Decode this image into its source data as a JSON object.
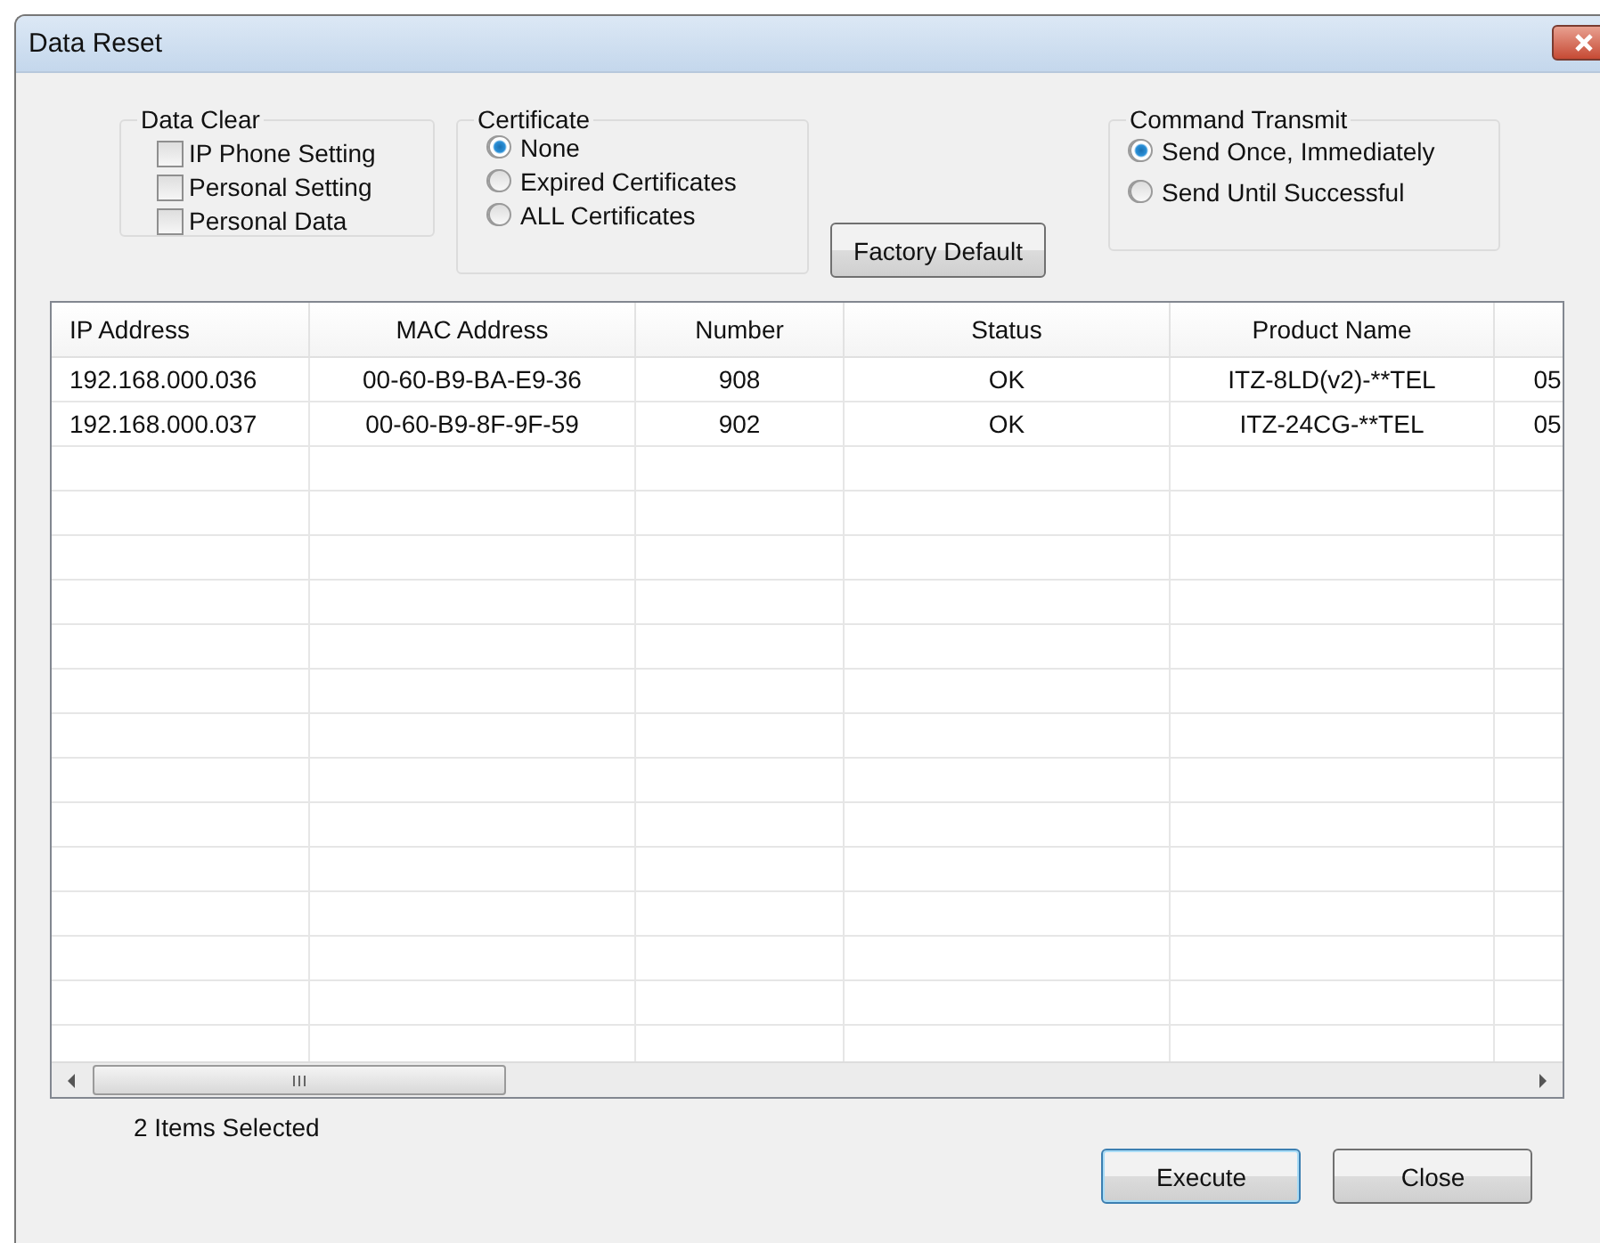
{
  "window": {
    "title": "Data Reset"
  },
  "data_clear": {
    "title": "Data Clear",
    "options": [
      {
        "label": "IP Phone Setting",
        "checked": false
      },
      {
        "label": "Personal Setting",
        "checked": false
      },
      {
        "label": "Personal Data",
        "checked": false
      }
    ]
  },
  "certificate": {
    "title": "Certificate",
    "options": [
      {
        "label": "None",
        "selected": true
      },
      {
        "label": "Expired Certificates",
        "selected": false
      },
      {
        "label": "ALL Certificates",
        "selected": false
      }
    ]
  },
  "factory_default_button": "Factory Default",
  "command_transmit": {
    "title": "Command Transmit",
    "options": [
      {
        "label": "Send Once, Immediately",
        "selected": true
      },
      {
        "label": "Send Until Successful",
        "selected": false
      }
    ]
  },
  "table": {
    "columns": [
      "IP Address",
      "MAC Address",
      "Number",
      "Status",
      "Product Name"
    ],
    "rows": [
      {
        "cells": [
          "192.168.000.036",
          "00-60-B9-BA-E9-36",
          "908",
          "OK",
          "ITZ-8LD(v2)-**TEL",
          "05"
        ]
      },
      {
        "cells": [
          "192.168.000.037",
          "00-60-B9-8F-9F-59",
          "902",
          "OK",
          "ITZ-24CG-**TEL",
          "05"
        ]
      }
    ]
  },
  "status_text": "2 Items Selected",
  "buttons": [
    {
      "label": "Execute",
      "default": true
    },
    {
      "label": "Close",
      "default": false
    }
  ]
}
